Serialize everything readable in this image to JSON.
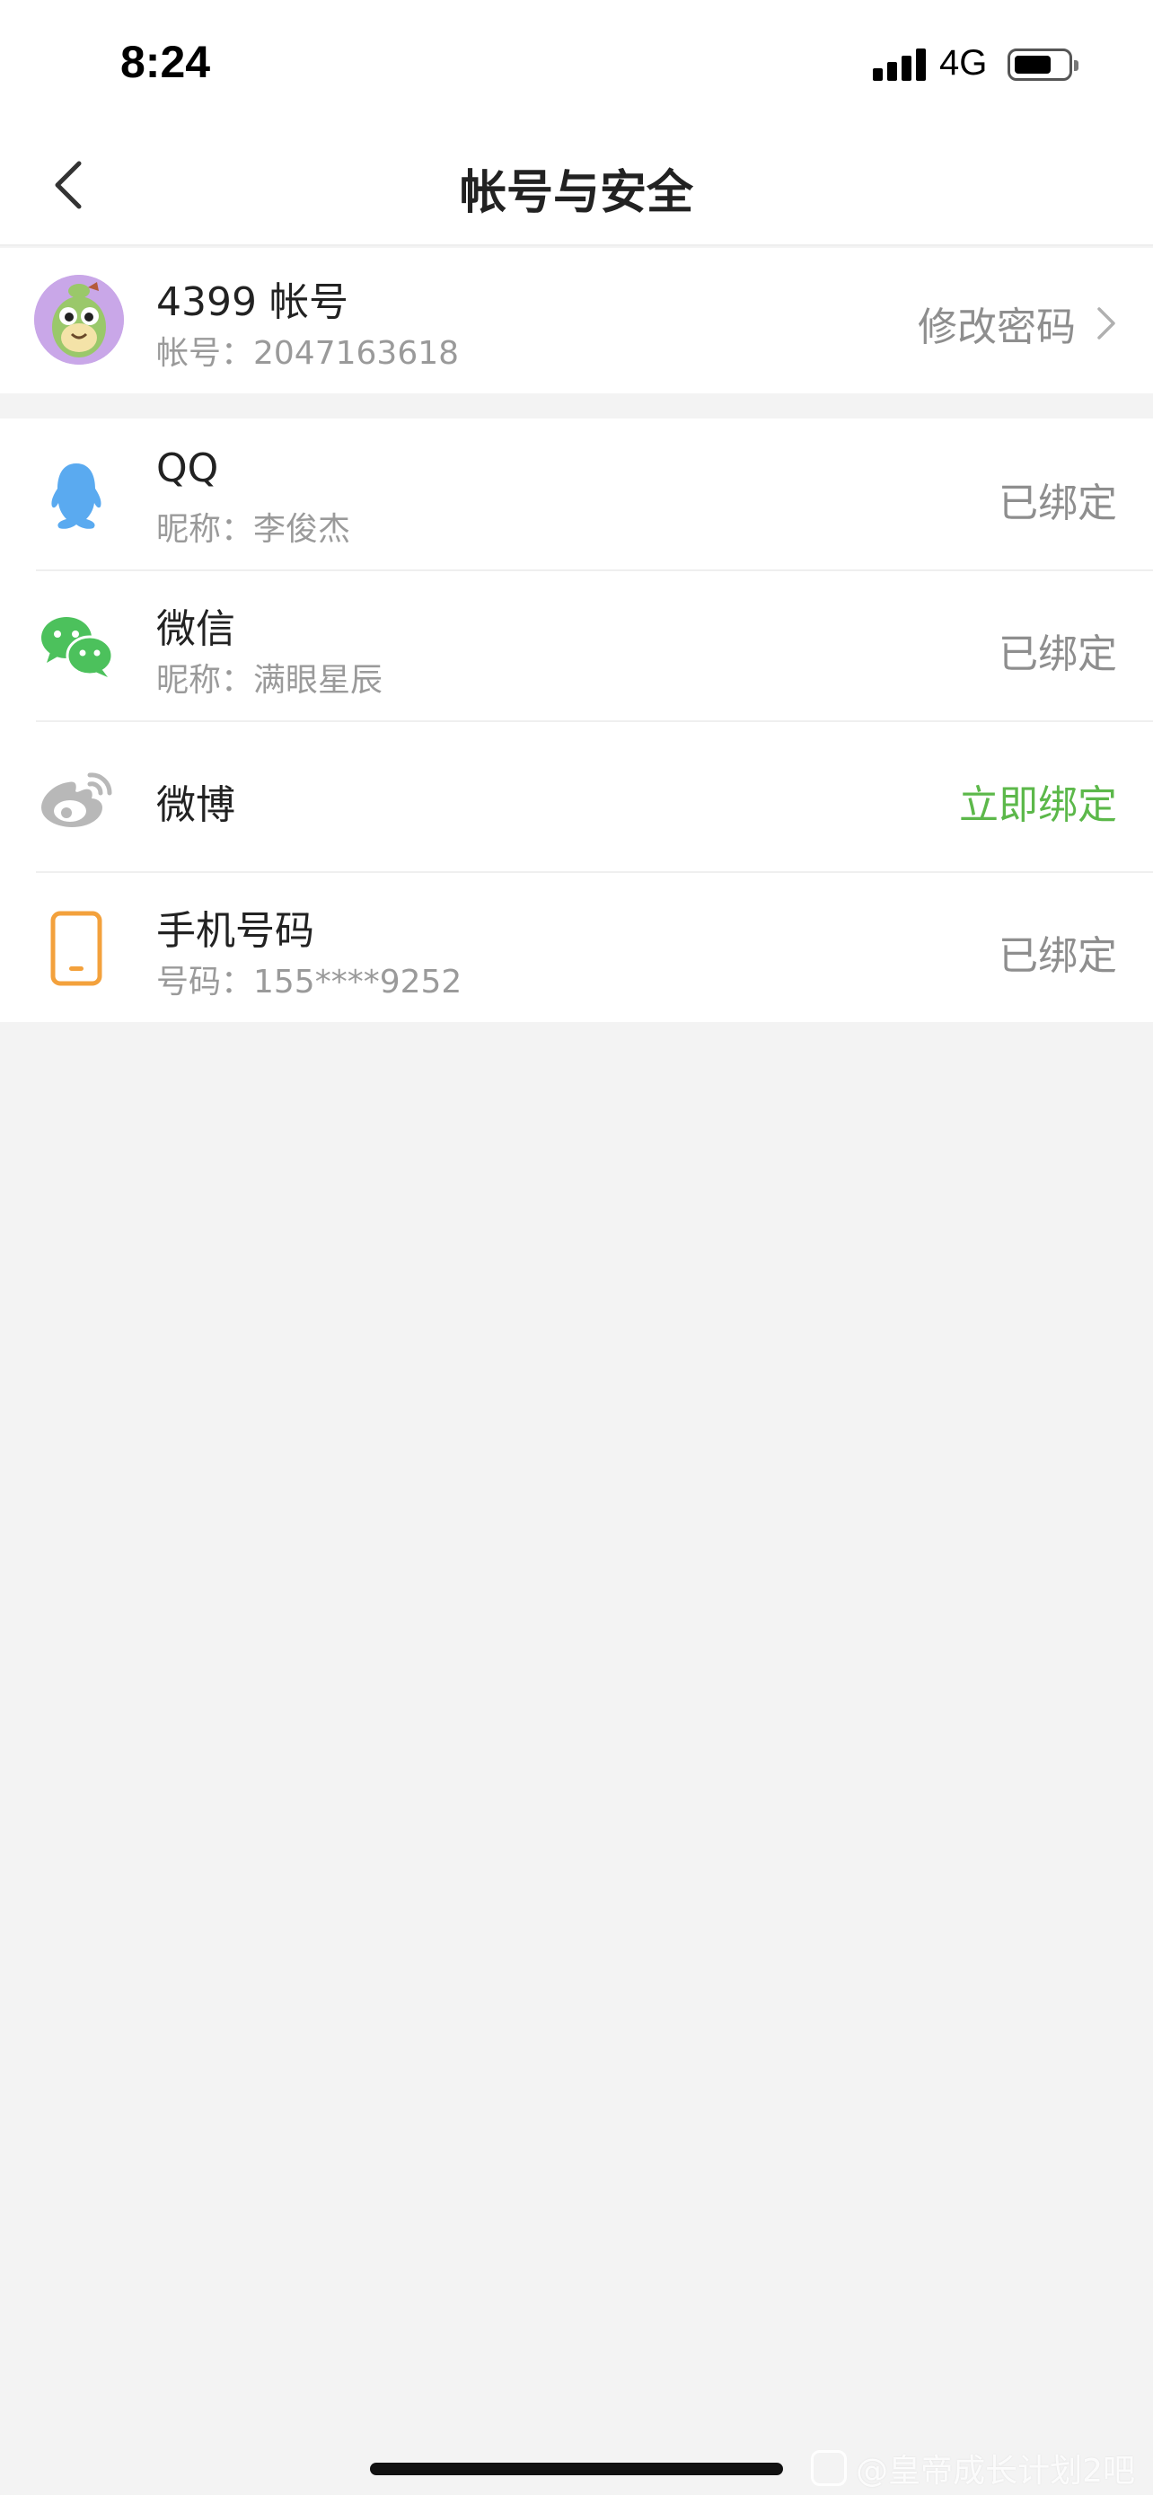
{
  "status_bar": {
    "time": "8:24",
    "network": "4G"
  },
  "nav": {
    "title": "帐号与安全"
  },
  "account": {
    "title": "4399 帐号",
    "subtitle": "帐号：2047163618",
    "action_label": "修改密码"
  },
  "bindings": [
    {
      "icon": "qq-icon",
      "title": "QQ",
      "subtitle": "昵称：李俊杰",
      "status": "已绑定"
    },
    {
      "icon": "wechat-icon",
      "title": "微信",
      "subtitle": "昵称：满眼星辰",
      "status": "已绑定"
    },
    {
      "icon": "weibo-icon",
      "title": "微博",
      "subtitle": "",
      "status": "立即绑定"
    },
    {
      "icon": "phone-icon",
      "title": "手机号码",
      "subtitle": "号码：155****9252",
      "status": "已绑定"
    }
  ],
  "colors": {
    "accent_green": "#5cb84a",
    "qq_blue": "#5aaaf0",
    "wechat_green": "#4cc15c",
    "phone_orange": "#f3a13c"
  },
  "watermark": "@皇帝成长计划2吧"
}
